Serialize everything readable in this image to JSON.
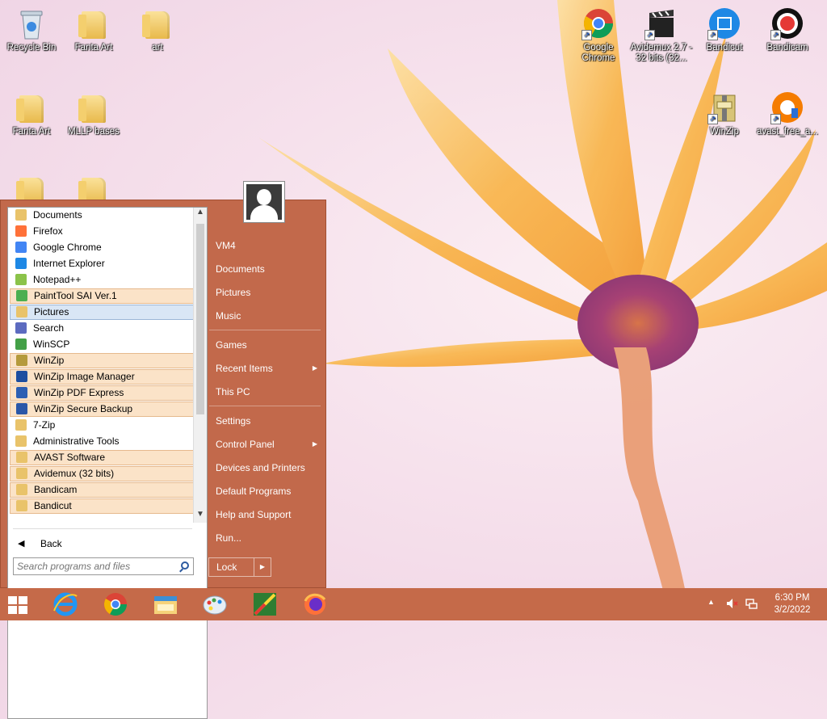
{
  "desktop": {
    "icons": [
      {
        "label": "Recycle Bin",
        "icon": "recycle-bin-icon"
      },
      {
        "label": "Fanta Art",
        "icon": "folder-icon"
      },
      {
        "label": "art",
        "icon": "folder-icon"
      },
      {
        "label": "Fanta Art",
        "icon": "folder-icon"
      },
      {
        "label": "MLLP bases",
        "icon": "folder-icon"
      },
      {
        "label": "Google Chrome",
        "icon": "chrome-icon"
      },
      {
        "label": "Avidemux 2.7 - 32 bits (32...",
        "icon": "avidemux-icon"
      },
      {
        "label": "Bandicut",
        "icon": "bandicut-icon"
      },
      {
        "label": "Bandicam",
        "icon": "bandicam-icon"
      },
      {
        "label": "WinZip",
        "icon": "winzip-icon"
      },
      {
        "label": "avast_free_a...",
        "icon": "avast-icon"
      }
    ]
  },
  "start_menu": {
    "programs": [
      {
        "label": "Documents",
        "icon": "documents-folder-icon",
        "color": "#e9c36a",
        "state": "normal"
      },
      {
        "label": "Firefox",
        "icon": "firefox-icon",
        "color": "#ff7139",
        "state": "normal"
      },
      {
        "label": "Google Chrome",
        "icon": "chrome-icon",
        "color": "#4285f4",
        "state": "normal"
      },
      {
        "label": "Internet Explorer",
        "icon": "internet-explorer-icon",
        "color": "#1e88e5",
        "state": "normal"
      },
      {
        "label": "Notepad++",
        "icon": "notepad-plus-plus-icon",
        "color": "#8bc34a",
        "state": "normal"
      },
      {
        "label": "PaintTool SAI Ver.1",
        "icon": "painttool-sai-icon",
        "color": "#4caf50",
        "state": "highlighted"
      },
      {
        "label": "Pictures",
        "icon": "pictures-folder-icon",
        "color": "#e9c36a",
        "state": "selected"
      },
      {
        "label": "Search",
        "icon": "search-icon",
        "color": "#5c6bc0",
        "state": "normal"
      },
      {
        "label": "WinSCP",
        "icon": "winscp-icon",
        "color": "#43a047",
        "state": "normal"
      },
      {
        "label": "WinZip",
        "icon": "winzip-icon",
        "color": "#b59a3c",
        "state": "highlighted"
      },
      {
        "label": "WinZip Image Manager",
        "icon": "winzip-image-manager-icon",
        "color": "#1e4fa0",
        "state": "highlighted"
      },
      {
        "label": "WinZip PDF Express",
        "icon": "winzip-pdf-express-icon",
        "color": "#2c5fb3",
        "state": "highlighted"
      },
      {
        "label": "WinZip Secure Backup",
        "icon": "winzip-secure-backup-icon",
        "color": "#2a57a8",
        "state": "highlighted"
      },
      {
        "label": "7-Zip",
        "icon": "folder-icon",
        "color": "#e9c36a",
        "state": "normal"
      },
      {
        "label": "Administrative Tools",
        "icon": "folder-icon",
        "color": "#e9c36a",
        "state": "normal"
      },
      {
        "label": "AVAST Software",
        "icon": "folder-icon",
        "color": "#e9c36a",
        "state": "highlighted"
      },
      {
        "label": "Avidemux (32 bits)",
        "icon": "folder-icon",
        "color": "#e9c36a",
        "state": "highlighted"
      },
      {
        "label": "Bandicam",
        "icon": "folder-icon",
        "color": "#e9c36a",
        "state": "highlighted"
      },
      {
        "label": "Bandicut",
        "icon": "folder-icon",
        "color": "#e9c36a",
        "state": "highlighted"
      }
    ],
    "back_label": "Back",
    "search_placeholder": "Search programs and files",
    "right_items": [
      {
        "label": "VM4",
        "has_submenu": false
      },
      {
        "label": "Documents",
        "has_submenu": false
      },
      {
        "label": "Pictures",
        "has_submenu": false
      },
      {
        "label": "Music",
        "has_submenu": false
      },
      {
        "label": "Games",
        "has_submenu": false
      },
      {
        "label": "Recent Items",
        "has_submenu": true
      },
      {
        "label": "This PC",
        "has_submenu": false
      },
      {
        "label": "Settings",
        "has_submenu": false
      },
      {
        "label": "Control Panel",
        "has_submenu": true
      },
      {
        "label": "Devices and Printers",
        "has_submenu": false
      },
      {
        "label": "Default Programs",
        "has_submenu": false
      },
      {
        "label": "Help and Support",
        "has_submenu": false
      },
      {
        "label": "Run...",
        "has_submenu": false
      }
    ],
    "submenu_arrow": "▶",
    "lock_label": "Lock",
    "lock_arrow": "▶"
  },
  "taskbar": {
    "apps": [
      {
        "icon": "internet-explorer-icon"
      },
      {
        "icon": "chrome-icon"
      },
      {
        "icon": "file-explorer-icon"
      },
      {
        "icon": "paint-icon"
      },
      {
        "icon": "painttool-sai-icon"
      },
      {
        "icon": "firefox-icon"
      }
    ],
    "tray_arrow": "▲",
    "time": "6:30 PM",
    "date": "3/2/2022"
  },
  "colors": {
    "start_menu_bg": "#c2694b",
    "taskbar_bg": "#c56a49",
    "highlight": "#fbe3c8"
  }
}
